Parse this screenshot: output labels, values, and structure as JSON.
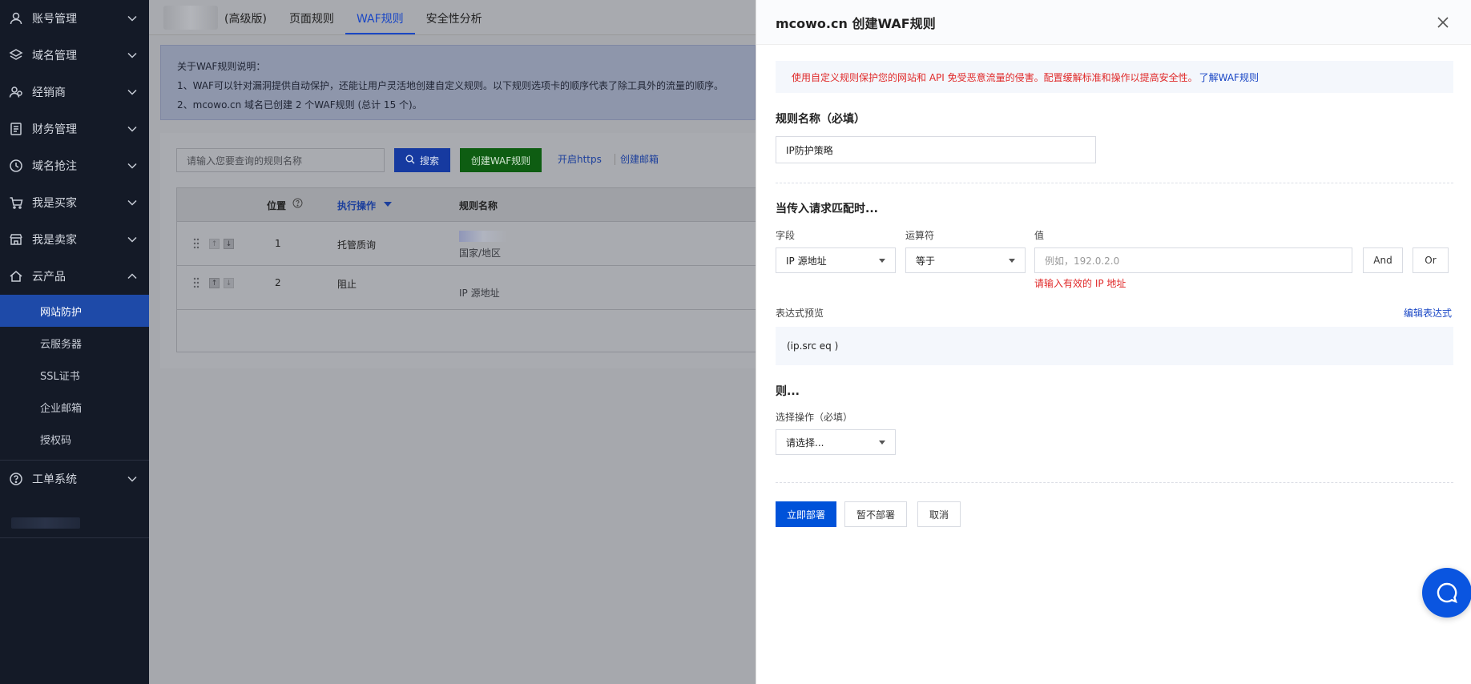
{
  "sidebar": {
    "items": [
      {
        "label": "账号管理",
        "icon": "user-icon"
      },
      {
        "label": "域名管理",
        "icon": "layers-icon"
      },
      {
        "label": "经销商",
        "icon": "user-group-icon"
      },
      {
        "label": "财务管理",
        "icon": "ledger-icon"
      },
      {
        "label": "域名抢注",
        "icon": "clock-icon"
      },
      {
        "label": "我是买家",
        "icon": "cart-icon"
      },
      {
        "label": "我是卖家",
        "icon": "store-icon"
      },
      {
        "label": "云产品",
        "icon": "cloud-icon"
      }
    ],
    "subitems": [
      "网站防护",
      "云服务器",
      "SSL证书",
      "企业邮箱",
      "授权码"
    ],
    "bottom_item": {
      "label": "工单系统",
      "icon": "help-circle-icon"
    }
  },
  "tabs": [
    "(高级版)",
    "页面规则",
    "WAF规则",
    "安全性分析"
  ],
  "notice": {
    "title": "关于WAF规则说明：",
    "line1": "1、WAF可以针对漏洞提供自动保护，还能让用户灵活地创建自定义规则。以下规则选项卡的顺序代表了除工具外的流量的顺序。",
    "line2": "2、mcowo.cn 域名已创建 2 个WAF规则 (总计 15 个)。"
  },
  "toolbar": {
    "search_placeholder": "请输入您要查询的规则名称",
    "search_button": "搜索",
    "create_button": "创建WAF规则",
    "link_https": "开启https",
    "link_email": "创建邮箱"
  },
  "table": {
    "headers": {
      "position": "位置",
      "action": "执行操作",
      "name": "规则名称"
    },
    "rows": [
      {
        "position": "1",
        "action": "托管质询",
        "name": "国家/地区"
      },
      {
        "position": "2",
        "action": "阻止",
        "name": "IP 源地址"
      }
    ]
  },
  "panel": {
    "title": "mcowo.cn 创建WAF规则",
    "alert_text": "使用自定义规则保护您的网站和 API 免受恶意流量的侵害。配置缓解标准和操作以提高安全性。",
    "alert_link": "了解WAF规则",
    "rule_name_label": "规则名称（必填）",
    "rule_name_value": "IP防护策略",
    "match_title": "当传入请求匹配时...",
    "field_label": "字段",
    "operator_label": "运算符",
    "value_label": "值",
    "field_value": "IP 源地址",
    "operator_value": "等于",
    "value_placeholder": "例如，192.0.2.0",
    "and_button": "And",
    "or_button": "Or",
    "value_error": "请输入有效的 IP 地址",
    "expr_label": "表达式预览",
    "edit_expr": "编辑表达式",
    "expr_value": "(ip.src eq )",
    "then_title": "则...",
    "action_label": "选择操作（必填）",
    "action_placeholder": "请选择...",
    "deploy_button": "立即部署",
    "hold_button": "暂不部署",
    "cancel_button": "取消"
  },
  "colors": {
    "primary": "#0052d9",
    "danger": "#e02a2a",
    "sidebar_bg": "#141a27",
    "active_sub": "#1e4aa8"
  }
}
